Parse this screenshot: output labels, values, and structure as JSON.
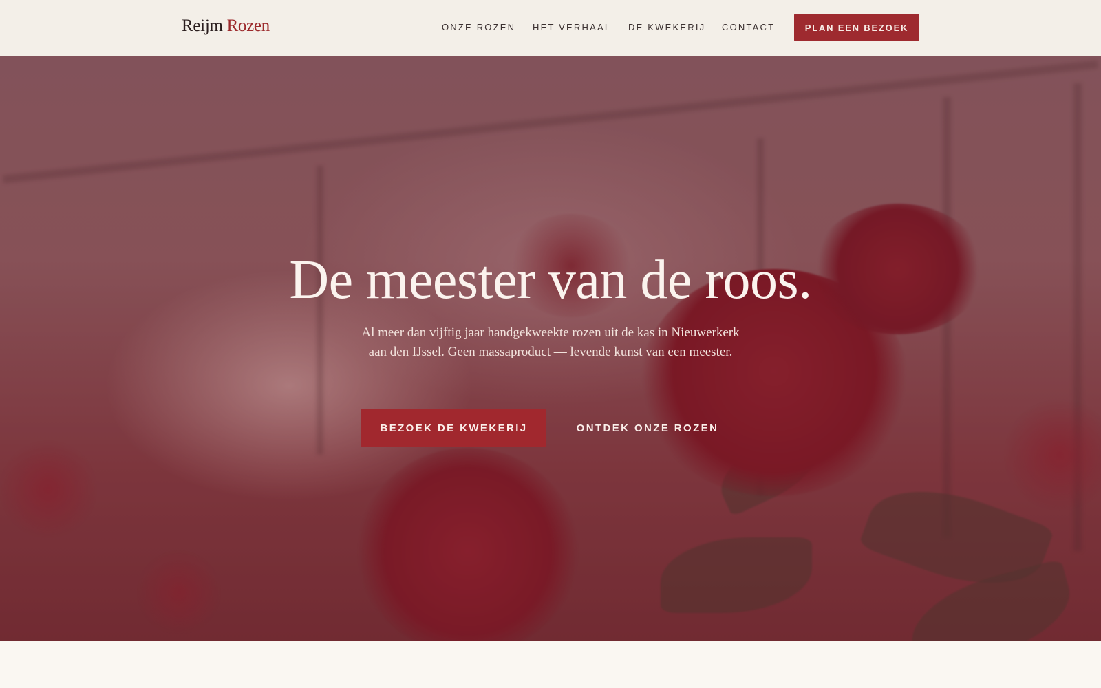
{
  "header": {
    "logo_first": "Reijm",
    "logo_second": "Rozen",
    "nav": [
      {
        "label": "ONZE ROZEN"
      },
      {
        "label": "HET VERHAAL"
      },
      {
        "label": "DE KWEKERIJ"
      },
      {
        "label": "CONTACT"
      }
    ],
    "cta_label": "PLAN EEN BEZOEK"
  },
  "hero": {
    "title": "De meester van de roos.",
    "subtitle": "Al meer dan vijftig jaar handgekweekte rozen uit de kas in Nieuwerkerk aan den IJssel. Geen massaproduct — levende kunst van een meester.",
    "primary_button": "BEZOEK DE KWEKERIJ",
    "secondary_button": "ONTDEK ONZE ROZEN"
  },
  "colors": {
    "accent": "#9e2a2f",
    "header_bg": "#f3efe8",
    "page_bg": "#faf7f2"
  }
}
